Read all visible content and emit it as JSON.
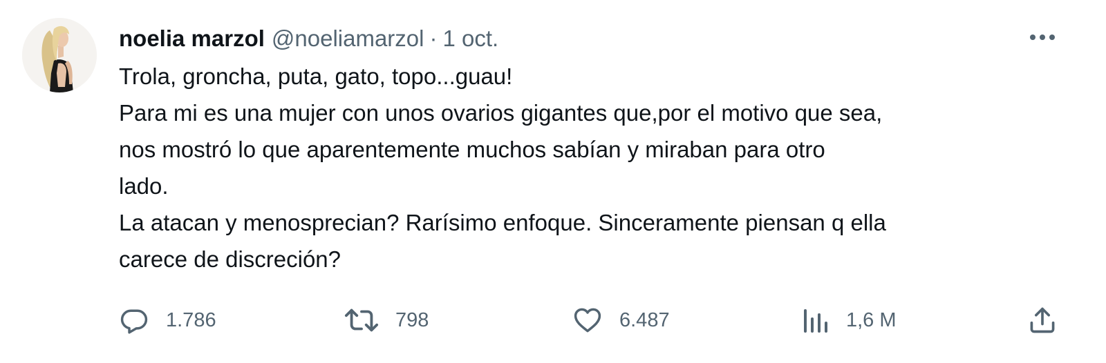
{
  "author": {
    "display_name": "noelia marzol",
    "handle": "@noeliamarzol",
    "separator": "·",
    "date": "1 oct.",
    "avatar_icon": "profile-photo"
  },
  "tweet": {
    "lines": [
      "Trola, groncha, puta, gato, topo...guau!",
      "Para mi es una mujer con unos ovarios gigantes que,por el motivo que sea,",
      "nos mostró lo que aparentemente muchos sabían y miraban para otro",
      "lado.",
      "La atacan y menosprecian? Rarísimo enfoque. Sinceramente piensan q ella",
      "carece de discreción?"
    ]
  },
  "actions": {
    "reply": {
      "icon": "reply-icon",
      "count": "1.786"
    },
    "retweet": {
      "icon": "retweet-icon",
      "count": "798"
    },
    "like": {
      "icon": "heart-icon",
      "count": "6.487"
    },
    "views": {
      "icon": "views-icon",
      "count": "1,6 M"
    },
    "share": {
      "icon": "share-icon"
    }
  },
  "colors": {
    "text_primary": "#0f1419",
    "text_secondary": "#536471",
    "background": "#ffffff"
  }
}
